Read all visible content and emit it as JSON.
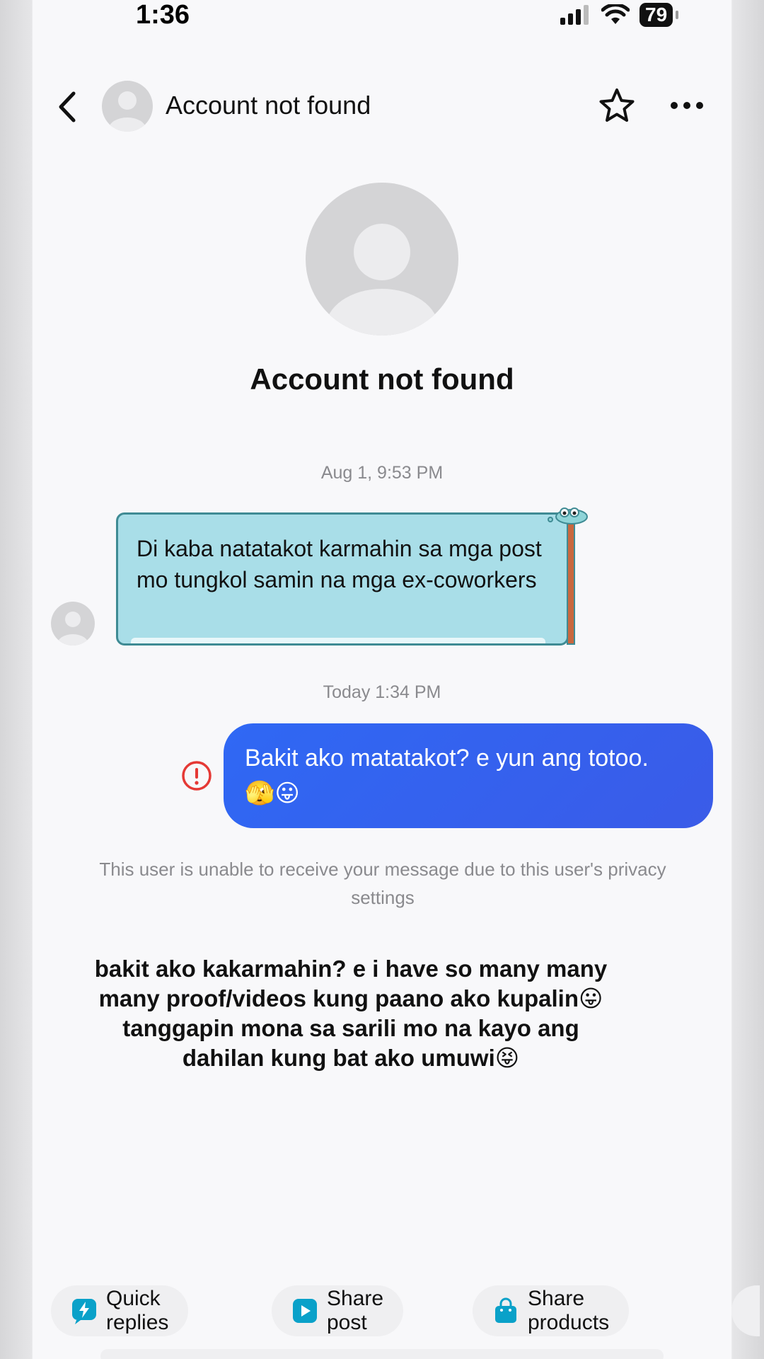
{
  "status_bar": {
    "time": "1:36",
    "battery": "79"
  },
  "header": {
    "title": "Account not found"
  },
  "profile": {
    "name": "Account not found"
  },
  "messages": [
    {
      "timestamp": "Aug 1, 9:53 PM",
      "text": "Di kaba natatakot karmahin sa mga post mo tungkol samin na mga ex-coworkers"
    },
    {
      "timestamp": "Today 1:34 PM",
      "text": "Bakit ako matatakot? e yun ang totoo.",
      "emojis": "🫣😛"
    }
  ],
  "notice": "This user is unable to receive your message due to this user's privacy settings",
  "caption": {
    "line1": "bakit ako kakarmahin? e i have so many many",
    "line2": "many proof/videos kung paano ako kupalin😛",
    "line3": "tanggapin mona sa sarili mo na kayo ang",
    "line4": "dahilan kung bat ako umuwi😝"
  },
  "actions": [
    {
      "label": "Quick replies",
      "icon": "lightning-icon"
    },
    {
      "label": "Share post",
      "icon": "play-icon"
    },
    {
      "label": "Share products",
      "icon": "shopping-bag-icon"
    }
  ],
  "colors": {
    "accent": "#3a5be8",
    "incoming_bubble": "#a9dee8",
    "error": "#e53935",
    "chip_icon": "#0aa1c9"
  }
}
